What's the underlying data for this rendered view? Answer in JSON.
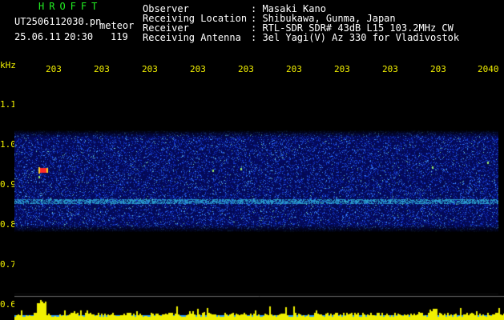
{
  "header": {
    "brand": "HROFFT",
    "filename": "UT2506112030.pn",
    "mode": "meteor",
    "date": "25.06.11",
    "time": "20:30",
    "count": "119",
    "fields": [
      {
        "label": "Observer",
        "value": ": Masaki Kano"
      },
      {
        "label": "Receiving Location",
        "value": ": Shibukawa, Gunma, Japan"
      },
      {
        "label": "Receiver",
        "value": ": RTL-SDR SDR# 43dB L15 103.2MHz CW"
      },
      {
        "label": "Receiving Antenna",
        "value": ": 3el Yagi(V) Az 330 for Vladivostok"
      }
    ]
  },
  "axes": {
    "unit": "kHz",
    "time_ticks": [
      "203",
      "203",
      "203",
      "203",
      "203",
      "203",
      "203",
      "203",
      "203",
      "2040"
    ],
    "freq_ticks": [
      "1.1",
      "1.0",
      "0.9",
      "0.8",
      "0.7",
      "0.6"
    ]
  },
  "colors": {
    "background": "#000000",
    "text": "#ffffff",
    "brand": "#22ee22",
    "axis": "#f2f000",
    "noise_dark": "#06106a",
    "noise_mid": "#1e3cd8",
    "noise_bright": "#4a8cff",
    "echo_hot": "#ff2020"
  }
}
